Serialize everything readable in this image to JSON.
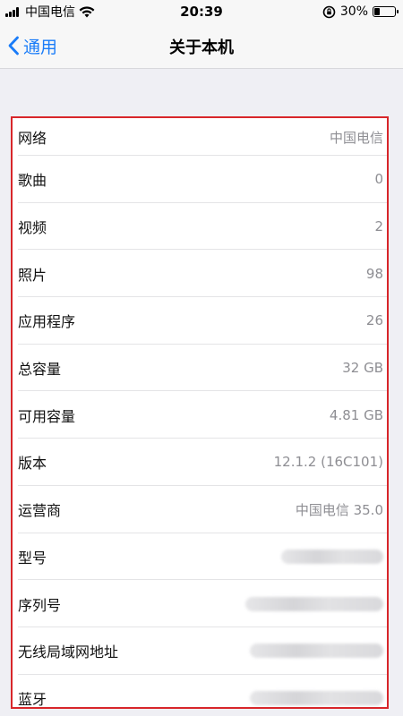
{
  "status_bar": {
    "carrier": "中国电信",
    "time": "20:39",
    "battery": "30%",
    "battery_level": 0.3
  },
  "nav": {
    "back_label": "通用",
    "title": "关于本机"
  },
  "rows": [
    {
      "label": "网络",
      "value": "中国电信"
    },
    {
      "label": "歌曲",
      "value": "0"
    },
    {
      "label": "视频",
      "value": "2"
    },
    {
      "label": "照片",
      "value": "98"
    },
    {
      "label": "应用程序",
      "value": "26"
    },
    {
      "label": "总容量",
      "value": "32 GB"
    },
    {
      "label": "可用容量",
      "value": "4.81 GB"
    },
    {
      "label": "版本",
      "value": "12.1.2 (16C101)"
    },
    {
      "label": "运营商",
      "value": "中国电信 35.0"
    },
    {
      "label": "型号",
      "value": ""
    },
    {
      "label": "序列号",
      "value": ""
    },
    {
      "label": "无线局域网地址",
      "value": ""
    },
    {
      "label": "蓝牙",
      "value": ""
    }
  ],
  "colors": {
    "accent": "#1a7cf8",
    "highlight_border": "#d8262a",
    "value_text": "#8e8e93",
    "background": "#efeff4"
  }
}
